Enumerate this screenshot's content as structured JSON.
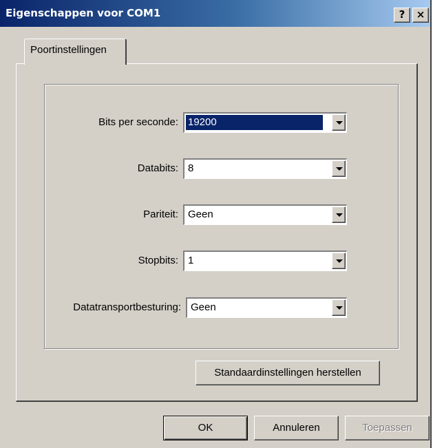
{
  "window": {
    "title": "Eigenschappen voor COM1",
    "help_label": "?",
    "close_label": "×"
  },
  "tabs": [
    {
      "label": "Poortinstellingen",
      "active": true
    }
  ],
  "fields": [
    {
      "label": "Bits per seconde:",
      "value": "19200",
      "selected": true
    },
    {
      "label": "Databits:",
      "value": "8"
    },
    {
      "label": "Pariteit:",
      "value": "Geen"
    },
    {
      "label": "Stopbits:",
      "value": "1"
    },
    {
      "label": "Datatransportbesturing:",
      "value": "Geen"
    }
  ],
  "buttons": {
    "restore_defaults": "Standaardinstellingen herstellen",
    "ok": "OK",
    "cancel": "Annuleren",
    "apply": "Toepassen"
  },
  "colors": {
    "title_gradient_start": "#0a246a",
    "title_gradient_end": "#a6caf0",
    "face": "#d4d0c8",
    "selection": "#0a246a"
  }
}
